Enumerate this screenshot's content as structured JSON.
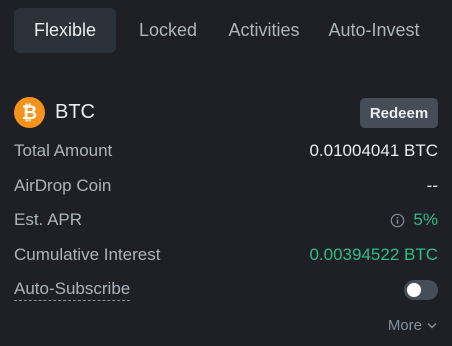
{
  "tabs": [
    {
      "label": "Flexible",
      "active": true
    },
    {
      "label": "Locked",
      "active": false
    },
    {
      "label": "Activities",
      "active": false
    },
    {
      "label": "Auto-Invest",
      "active": false
    }
  ],
  "coin": {
    "icon": "bitcoin-icon",
    "name": "BTC",
    "redeem_label": "Redeem"
  },
  "details": {
    "total_amount": {
      "label": "Total Amount",
      "value": "0.01004041 BTC"
    },
    "airdrop_coin": {
      "label": "AirDrop Coin",
      "value": "--"
    },
    "est_apr": {
      "label": "Est. APR",
      "value": "5%",
      "icon": "info-icon"
    },
    "cumulative_interest": {
      "label": "Cumulative Interest",
      "value": "0.00394522 BTC"
    },
    "auto_subscribe": {
      "label": "Auto-Subscribe",
      "enabled": false
    }
  },
  "more_label": "More",
  "colors": {
    "background": "#1e2026",
    "active_tab": "#2b3139",
    "green": "#2ebd85",
    "btc_orange": "#f7931a",
    "button": "#474d57"
  }
}
